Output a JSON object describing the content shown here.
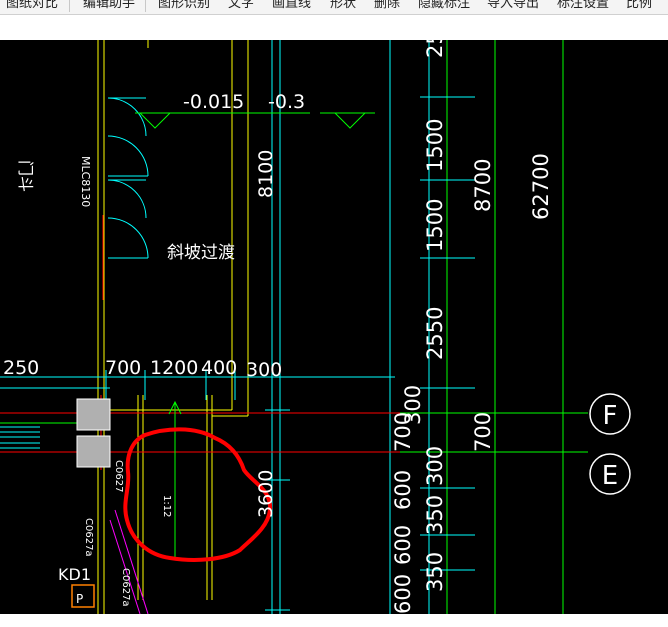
{
  "toolbar": {
    "items": [
      {
        "label": "图纸对比"
      },
      {
        "label": "编辑助手"
      },
      {
        "label": "图形识别"
      },
      {
        "label": "文字"
      },
      {
        "label": "画直线"
      },
      {
        "label": "形状"
      },
      {
        "label": "删除"
      },
      {
        "label": "隐藏标注"
      },
      {
        "label": "导入导出"
      },
      {
        "label": "标注设置"
      },
      {
        "label": "比例"
      }
    ]
  },
  "drawing": {
    "colors": {
      "background": "#000000",
      "dimension": "#00ffff",
      "axis": "#00ff00",
      "wall": "#ffff00",
      "centerline": "#ff0000",
      "text": "#ffffff",
      "door": "#00ffff",
      "markup": "#ff0000",
      "column": "#b0b0b0",
      "slope": "#ff00ff"
    },
    "texts": {
      "elev_1": "-0.015",
      "elev_2": "-0.3",
      "door_left": "门斗",
      "mlc_code": "MLC8130",
      "slope_note": "斜坡过渡",
      "dim_250": "250",
      "dim_700": "700",
      "dim_1200": "1200",
      "dim_400": "400",
      "dim_300": "300",
      "dim_8100": "8100",
      "dim_3600": "3600",
      "ramp_ratio": "1:12",
      "kd_label": "KD1",
      "c0627_a": "C0627",
      "c0627_b": "C0627a",
      "c0627_c": "C0627a",
      "plate_letter": "P"
    },
    "right_dims": {
      "col1": [
        "25",
        "1500",
        "1500",
        "2550",
        "300",
        "700",
        "300",
        "600",
        "350",
        "600",
        "350",
        "600"
      ],
      "col2": [
        "8700",
        "700"
      ],
      "col3": [
        "62700"
      ]
    },
    "axes": [
      {
        "label": "F"
      },
      {
        "label": "E"
      }
    ]
  }
}
